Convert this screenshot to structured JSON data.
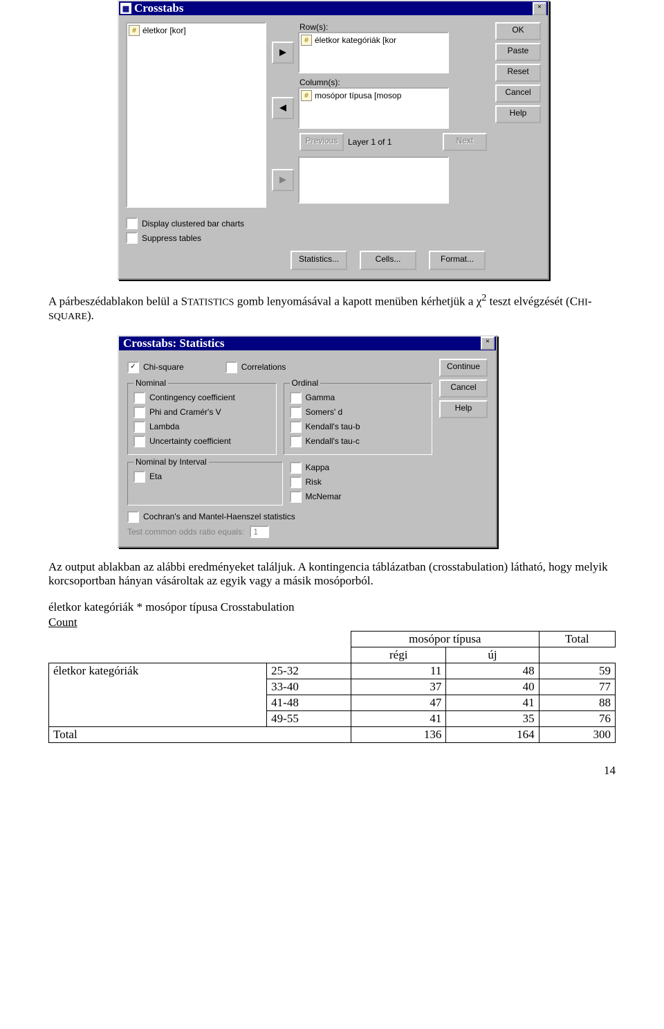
{
  "crosstabs": {
    "title": "Crosstabs",
    "source_list": "életkor [kor]",
    "row_label": "Row(s):",
    "row_value": "életkor kategóriák [kor",
    "col_label": "Column(s):",
    "col_value": "mosópor típusa [mosop",
    "prev": "Previous",
    "layer": "Layer 1 of 1",
    "next": "Next",
    "chk_bar": "Display clustered bar charts",
    "chk_supp": "Suppress tables",
    "btn_stats": "Statistics...",
    "btn_cells": "Cells...",
    "btn_format": "Format...",
    "side": {
      "ok": "OK",
      "paste": "Paste",
      "reset": "Reset",
      "cancel": "Cancel",
      "help": "Help"
    }
  },
  "para1_pre": "A párbeszédablakon belül a S",
  "para1_sc": "TATISTICS",
  "para1_mid": " gomb lenyomásával a kapott menüben kérhetjük a χ",
  "para1_sup": "2",
  "para1_post": " teszt elvégzését (C",
  "para1_sc2": "HI",
  "para1_dash": "-",
  "para1_sc3": "SQUARE",
  "para1_end": ").",
  "stats": {
    "title": "Crosstabs: Statistics",
    "chi": "Chi-square",
    "corr": "Correlations",
    "nominal": "Nominal",
    "cc": "Contingency coefficient",
    "phi": "Phi and Cramér's V",
    "lambda": "Lambda",
    "unc": "Uncertainty coefficient",
    "ordinal": "Ordinal",
    "gamma": "Gamma",
    "somers": "Somers' d",
    "taub": "Kendall's tau-b",
    "tauc": "Kendall's tau-c",
    "nbi": "Nominal by Interval",
    "eta": "Eta",
    "kappa": "Kappa",
    "risk": "Risk",
    "mcn": "McNemar",
    "cmh": "Cochran's and Mantel-Haenszel statistics",
    "odr_label": "Test common odds ratio equals:",
    "odr_val": "1",
    "cont": "Continue",
    "cancel": "Cancel",
    "help": "Help"
  },
  "para2": "Az output ablakban az alábbi eredményeket találjuk. A kontingencia táblázatban (crosstabulation) látható, hogy melyik korcsoportban hányan vásároltak az egyik vagy a másik mosóporból.",
  "table": {
    "caption": "életkor kategóriák * mosópor típusa Crosstabulation",
    "count": "Count",
    "colhead": "mosópor típusa",
    "total": "Total",
    "regi": "régi",
    "uj": "új",
    "rowhead": "életkor kategóriák",
    "rows": [
      {
        "cat": "25-32",
        "a": "11",
        "b": "48",
        "t": "59"
      },
      {
        "cat": "33-40",
        "a": "37",
        "b": "40",
        "t": "77"
      },
      {
        "cat": "41-48",
        "a": "47",
        "b": "41",
        "t": "88"
      },
      {
        "cat": "49-55",
        "a": "41",
        "b": "35",
        "t": "76"
      }
    ],
    "totrow": {
      "label": "Total",
      "a": "136",
      "b": "164",
      "t": "300"
    }
  },
  "pagenum": "14"
}
